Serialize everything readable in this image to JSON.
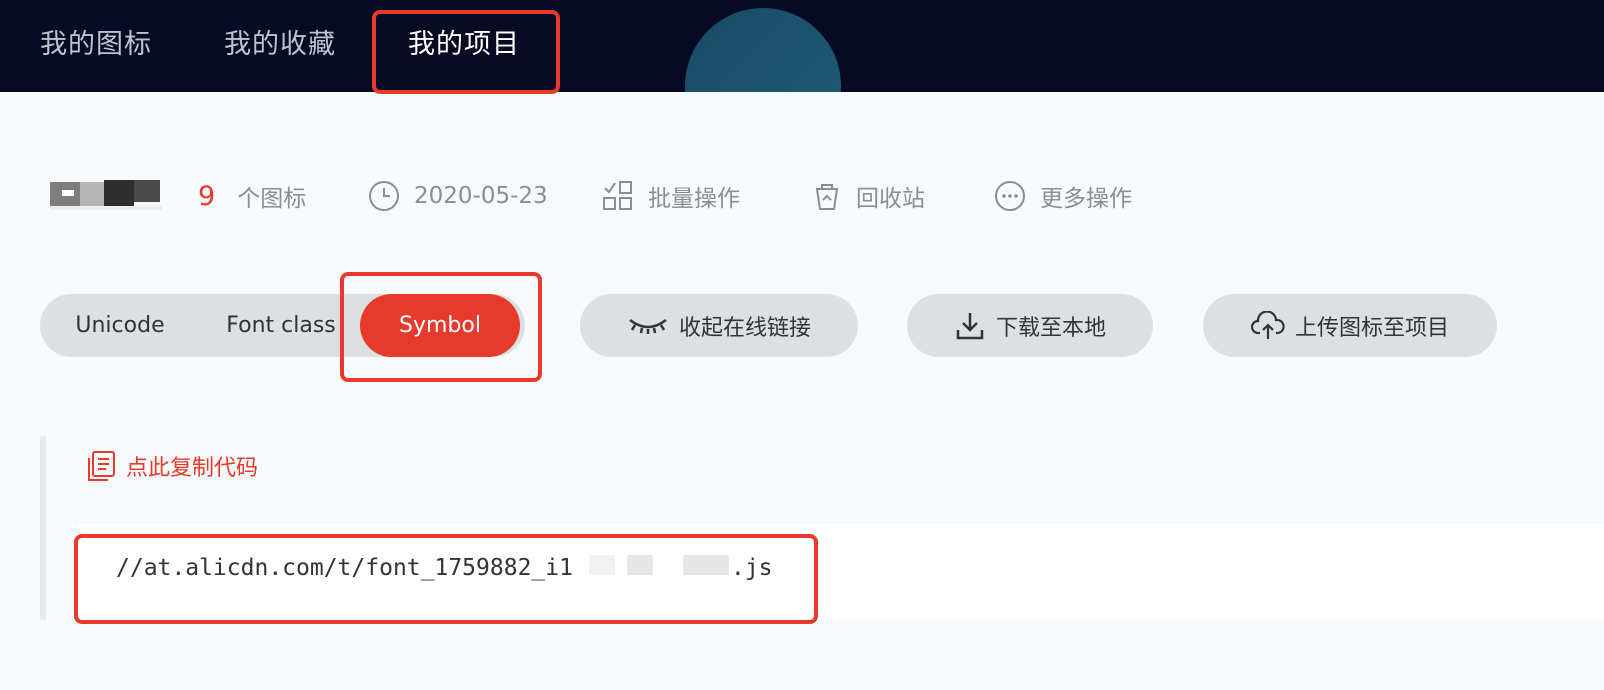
{
  "nav": {
    "tabs": [
      {
        "label": "我的图标"
      },
      {
        "label": "我的收藏"
      },
      {
        "label": "我的项目",
        "active": true
      }
    ]
  },
  "project": {
    "icon_count": "9",
    "icon_count_label": "个图标",
    "date": "2020-05-23",
    "batch_label": "批量操作",
    "recycle_label": "回收站",
    "more_label": "更多操作"
  },
  "format_tabs": [
    {
      "label": "Unicode"
    },
    {
      "label": "Font class"
    },
    {
      "label": "Symbol",
      "active": true
    }
  ],
  "actions": {
    "collapse_link_label": "收起在线链接",
    "download_label": "下载至本地",
    "upload_label": "上传图标至项目"
  },
  "code": {
    "copy_label": "点此复制代码",
    "url_prefix": "//at.alicdn.com/t/font_1759882_i1",
    "url_suffix": ".js"
  },
  "colors": {
    "accent": "#e63a2c",
    "nav_bg": "#070a22",
    "pill_bg": "#dde0e3"
  }
}
